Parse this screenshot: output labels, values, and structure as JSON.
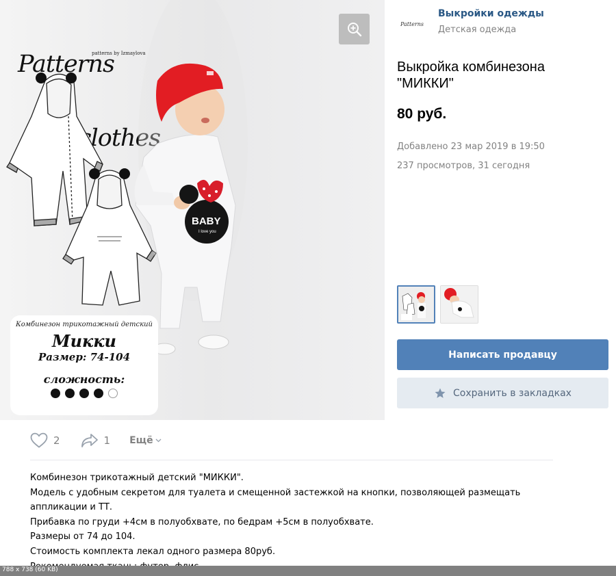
{
  "photo": {
    "brand_line1": "Patterns",
    "brand_line2": "clothes",
    "brand_sub": "patterns by Izmaylova",
    "baby_text": "BABY",
    "baby_subtext": "I love you",
    "card": {
      "description": "Комбинезон трикотажный детский",
      "name": "Микки",
      "size": "Размер: 74-104",
      "difficulty_label": "сложность:",
      "difficulty": {
        "filled": 4,
        "total": 5
      }
    },
    "zoom_icon": "zoom-in-icon"
  },
  "seller": {
    "logo_text": "Patterns",
    "name": "Выкройки одежды",
    "category": "Детская одежда"
  },
  "product": {
    "title": "Выкройка комбинезона \"МИККИ\"",
    "price": "80 руб.",
    "added": "Добавлено 23 мар 2019 в 19:50",
    "views": "237 просмотров, 31 сегодня"
  },
  "buttons": {
    "message_seller": "Написать продавцу",
    "save_bookmark": "Сохранить в закладках",
    "bookmark_icon": "star-icon"
  },
  "actions": {
    "likes": "2",
    "shares": "1",
    "more": "Ещё",
    "like_icon": "heart-icon",
    "share_icon": "share-arrow-icon"
  },
  "description": [
    "Комбинезон трикотажный детский \"МИККИ\".",
    "Модель с удобным секретом для туалета и смещенной застежкой на кнопки, позволяющей размещать",
    "аппликации и ТТ.",
    "Прибавка по груди +4см в полуобхвате, по бедрам +5см в полуобхвате.",
    "Размеры от 74 до 104.",
    "Стоимость комплекта лекал одного размера 80руб.",
    "Рекомендуемая ткань: футер, флис"
  ],
  "footer": {
    "image_info": "788 x 738 (60 KB)"
  },
  "colors": {
    "accent": "#5181b8",
    "link": "#2a5885",
    "muted": "#828282",
    "secondary_bg": "#e5ebf1",
    "hat_red": "#e21d23"
  }
}
